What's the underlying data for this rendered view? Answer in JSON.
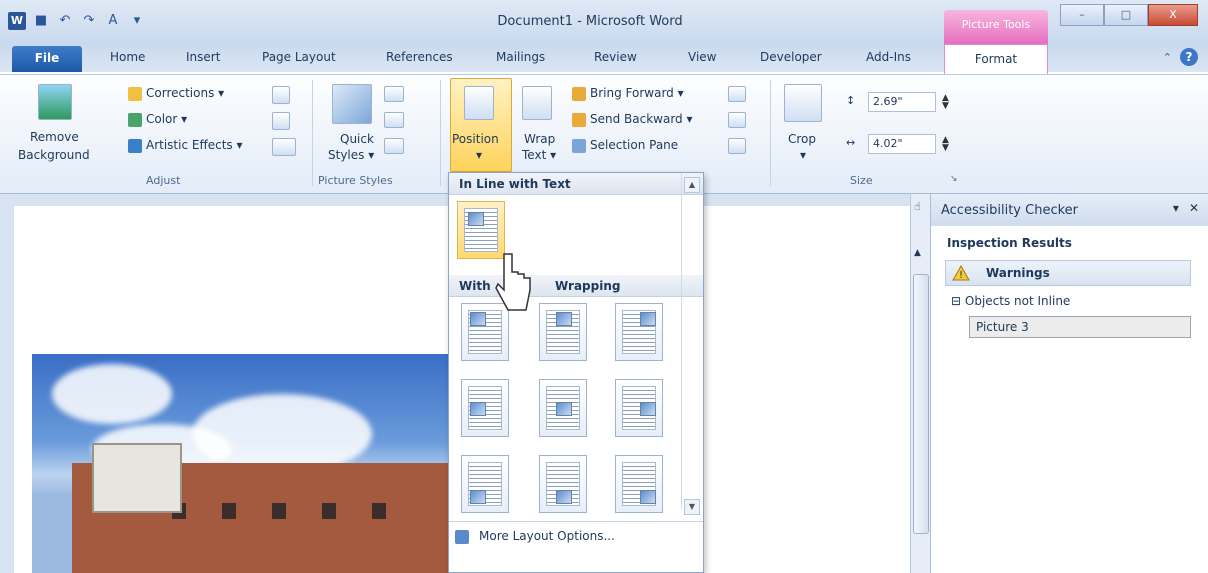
{
  "window": {
    "title": "Document1 - Microsoft Word",
    "context_tab": "Picture Tools",
    "controls": [
      "–",
      "□",
      "X"
    ]
  },
  "tabs": [
    "Home",
    "Insert",
    "Page Layout",
    "References",
    "Mailings",
    "Review",
    "View",
    "Developer",
    "Add-Ins"
  ],
  "file_tab": "File",
  "format_tab": "Format",
  "ribbon": {
    "remove_background": [
      "Remove",
      "Background"
    ],
    "adjust": {
      "corrections": "Corrections",
      "color": "Color",
      "artistic_effects": "Artistic Effects",
      "label": "Adjust"
    },
    "picture_styles": {
      "quick_styles": [
        "Quick",
        "Styles"
      ],
      "label": "Picture Styles"
    },
    "arrange": {
      "position": "Position",
      "wrap_text": [
        "Wrap",
        "Text"
      ],
      "bring_forward": "Bring Forward",
      "send_backward": "Send Backward",
      "selection_pane": "Selection Pane"
    },
    "size": {
      "crop": "Crop",
      "height": "2.69\"",
      "width": "4.02\"",
      "label": "Size"
    }
  },
  "position_menu": {
    "section1": "In Line with Text",
    "section2_parts": [
      "With",
      "Wrapping"
    ],
    "more_options": "More Layout Options..."
  },
  "accessibility": {
    "title": "Accessibility Checker",
    "inspection": "Inspection Results",
    "warnings": "Warnings",
    "objects_not_inline": "Objects not Inline",
    "item": "Picture 3"
  },
  "colors": {
    "file_tab": "#2b65b5",
    "context_tab": "#e66fc0"
  }
}
